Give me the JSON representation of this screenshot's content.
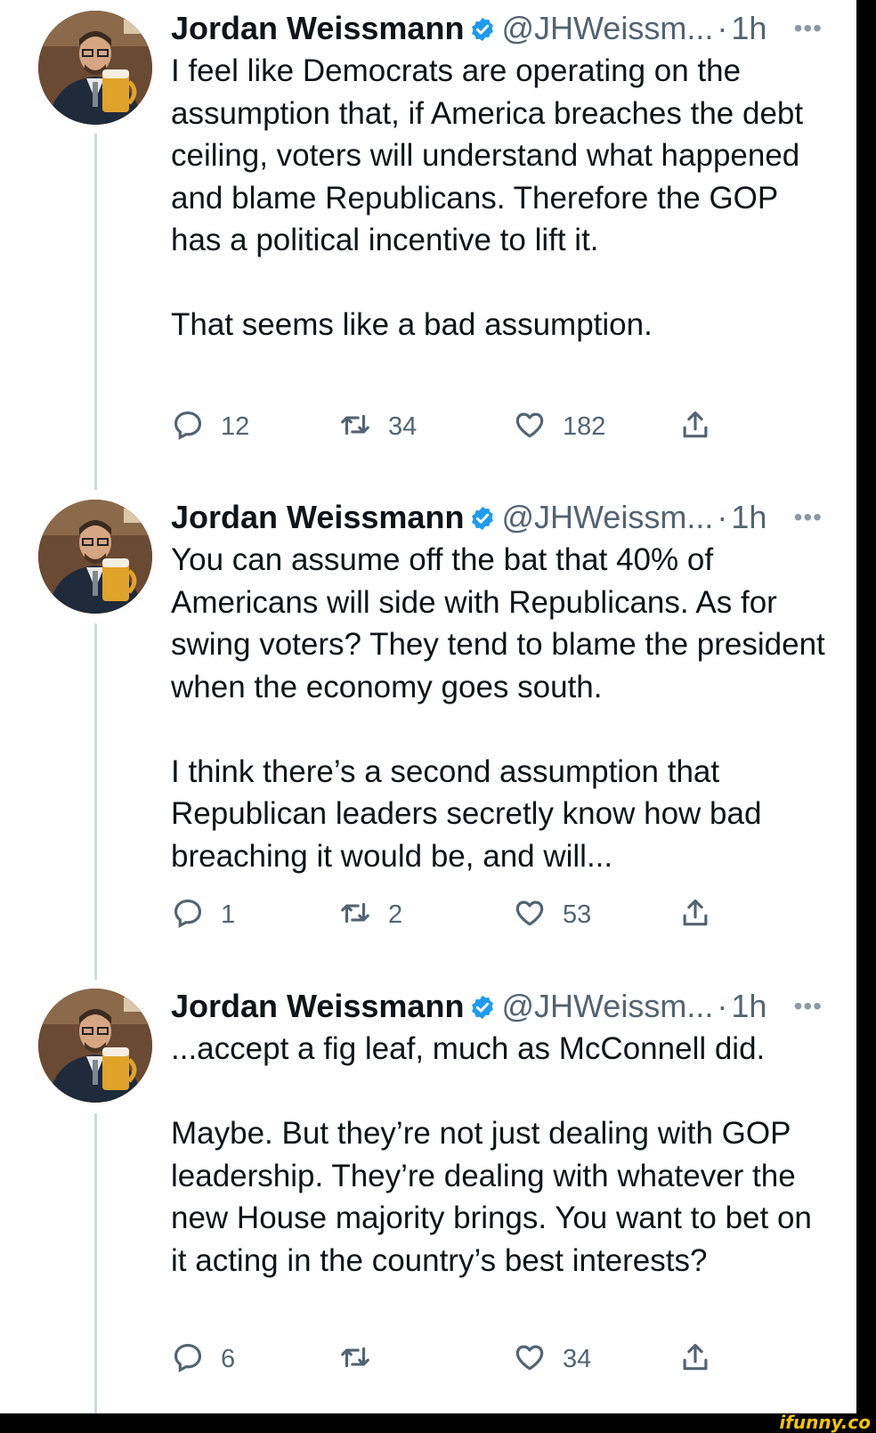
{
  "tweets": [
    {
      "author": {
        "name": "Jordan Weissmann",
        "handle": "@JHWeissm...",
        "time": "1h",
        "verified": true
      },
      "paragraphs": [
        "I feel like Democrats are operating on the assumption that, if America breaches the debt ceiling, voters will understand what happened and blame Republicans. Therefore the GOP has a political incentive to lift it.",
        "That seems like a bad assumption."
      ],
      "stats": {
        "replies": "12",
        "retweets": "34",
        "likes": "182"
      }
    },
    {
      "author": {
        "name": "Jordan Weissmann",
        "handle": "@JHWeissm...",
        "time": "1h",
        "verified": true
      },
      "paragraphs": [
        "You can assume off the bat that 40% of Americans will side with Republicans. As for swing voters? They tend to blame the president when the economy goes south.",
        "I think there’s a second assumption that Republican leaders secretly know how bad breaching it would be, and will..."
      ],
      "stats": {
        "replies": "1",
        "retweets": "2",
        "likes": "53"
      }
    },
    {
      "author": {
        "name": "Jordan Weissmann",
        "handle": "@JHWeissm...",
        "time": "1h",
        "verified": true
      },
      "paragraphs": [
        "...accept a fig leaf, much as McConnell did.",
        "Maybe. But they’re not just dealing with GOP leadership. They’re dealing with whatever the new House majority brings. You want to bet on it acting in the country’s best interests?"
      ],
      "stats": {
        "replies": "6",
        "retweets": "",
        "likes": "34"
      }
    }
  ],
  "ui": {
    "separator": "·",
    "more_label": "•••"
  },
  "watermark": {
    "text": "ifunny.co"
  },
  "colors": {
    "verified": "#1d9bf0",
    "muted": "#536471",
    "text": "#0f1419",
    "thread": "#cfd9de"
  },
  "icons": {
    "reply": "reply-icon",
    "retweet": "retweet-icon",
    "like": "heart-icon",
    "share": "share-icon",
    "more": "more-icon",
    "verified": "verified-badge-icon"
  }
}
